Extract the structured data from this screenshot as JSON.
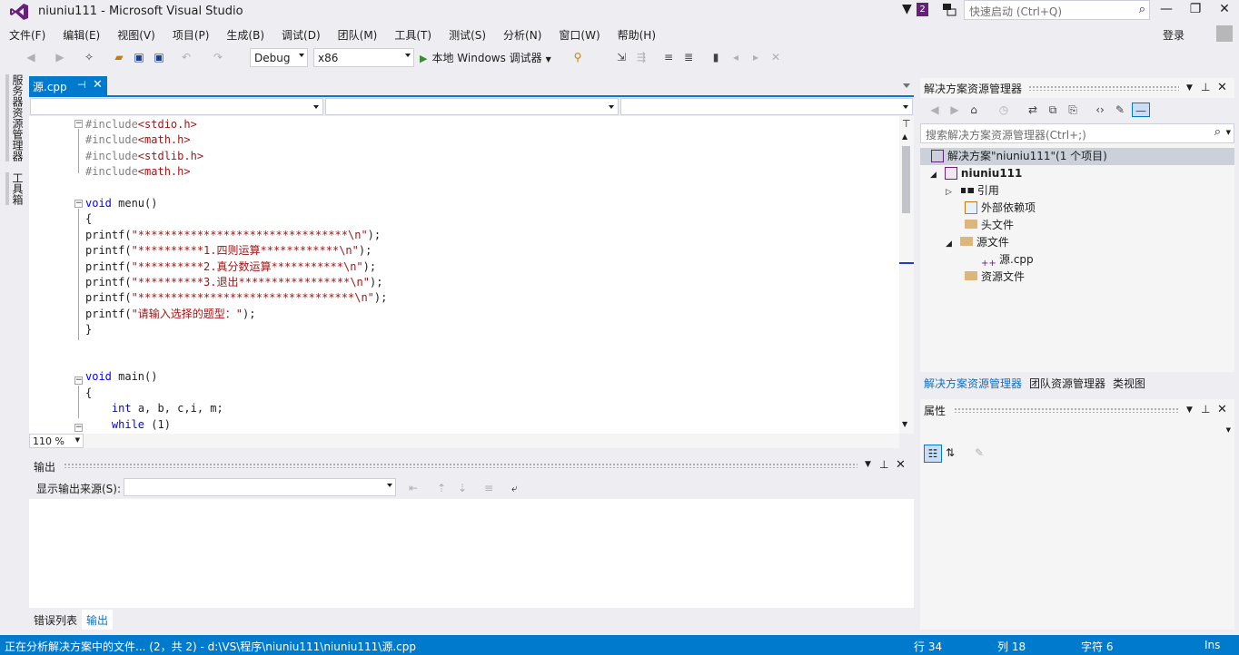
{
  "window": {
    "title": "niuniu111 - Microsoft Visual Studio",
    "notification_count": "2",
    "quick_launch_placeholder": "快速启动 (Ctrl+Q)",
    "login": "登录"
  },
  "menu": [
    "文件(F)",
    "编辑(E)",
    "视图(V)",
    "项目(P)",
    "生成(B)",
    "调试(D)",
    "团队(M)",
    "工具(T)",
    "测试(S)",
    "分析(N)",
    "窗口(W)",
    "帮助(H)"
  ],
  "toolbar": {
    "configuration": "Debug",
    "platform": "x86",
    "run_label": "本地 Windows 调试器"
  },
  "left_strip": {
    "server_explorer": "服务器资源管理器",
    "toolbox": "工具箱"
  },
  "document": {
    "tab_label": "源.cpp",
    "zoom": "110 %"
  },
  "code_lines": [
    {
      "t": "#include<stdio.h>",
      "k": "pp"
    },
    {
      "t": "#include<math.h>",
      "k": "pp"
    },
    {
      "t": "#include<stdlib.h>",
      "k": "pp"
    },
    {
      "t": "#include<math.h>",
      "k": "pp"
    },
    {
      "t": "",
      "k": ""
    },
    {
      "t": "void menu()",
      "k": "fn"
    },
    {
      "t": "{",
      "k": ""
    },
    {
      "t": "printf(\"********************************\\n\");",
      "k": "pf"
    },
    {
      "t": "printf(\"**********1.四则运算************\\n\");",
      "k": "pf"
    },
    {
      "t": "printf(\"**********2.真分数运算***********\\n\");",
      "k": "pf"
    },
    {
      "t": "printf(\"**********3.退出*****************\\n\");",
      "k": "pf"
    },
    {
      "t": "printf(\"*********************************\\n\");",
      "k": "pf"
    },
    {
      "t": "printf(\"请输入选择的题型：\");",
      "k": "pf"
    },
    {
      "t": "}",
      "k": ""
    },
    {
      "t": "",
      "k": ""
    },
    {
      "t": "",
      "k": ""
    },
    {
      "t": "void main()",
      "k": "fn"
    },
    {
      "t": "{",
      "k": ""
    },
    {
      "t": "    int a, b, c,i, m;",
      "k": "int"
    },
    {
      "t": "    while (1)",
      "k": "while"
    }
  ],
  "output": {
    "title": "输出",
    "source_label": "显示输出来源(S):",
    "source_value": ""
  },
  "bottom_tabs": [
    "错误列表",
    "输出"
  ],
  "solution_explorer": {
    "title": "解决方案资源管理器",
    "search_placeholder": "搜索解决方案资源管理器(Ctrl+;)",
    "tree": [
      {
        "label": "解决方案\"niuniu111\"(1 个项目)",
        "icon": "solution-icon"
      },
      {
        "label": "niuniu111",
        "icon": "project-icon"
      },
      {
        "label": "引用",
        "icon": "references-icon"
      },
      {
        "label": "外部依赖项",
        "icon": "external-deps-icon"
      },
      {
        "label": "头文件",
        "icon": "folder-icon"
      },
      {
        "label": "源文件",
        "icon": "folder-open-icon"
      },
      {
        "label": "源.cpp",
        "icon": "cpp-file-icon"
      },
      {
        "label": "资源文件",
        "icon": "folder-icon"
      }
    ],
    "tabs": [
      "解决方案资源管理器",
      "团队资源管理器",
      "类视图"
    ]
  },
  "properties": {
    "title": "属性"
  },
  "status": {
    "message": "正在分析解决方案中的文件... (2，共 2) - d:\\VS\\程序\\niuniu111\\niuniu111\\源.cpp",
    "line": "行 34",
    "col": "列 18",
    "char": "字符 6",
    "mode": "Ins"
  },
  "colors": {
    "accent": "#007acc",
    "vs_purple": "#68217a",
    "keyword": "#0000ff",
    "string": "#a31515",
    "preprocessor": "#808080"
  }
}
